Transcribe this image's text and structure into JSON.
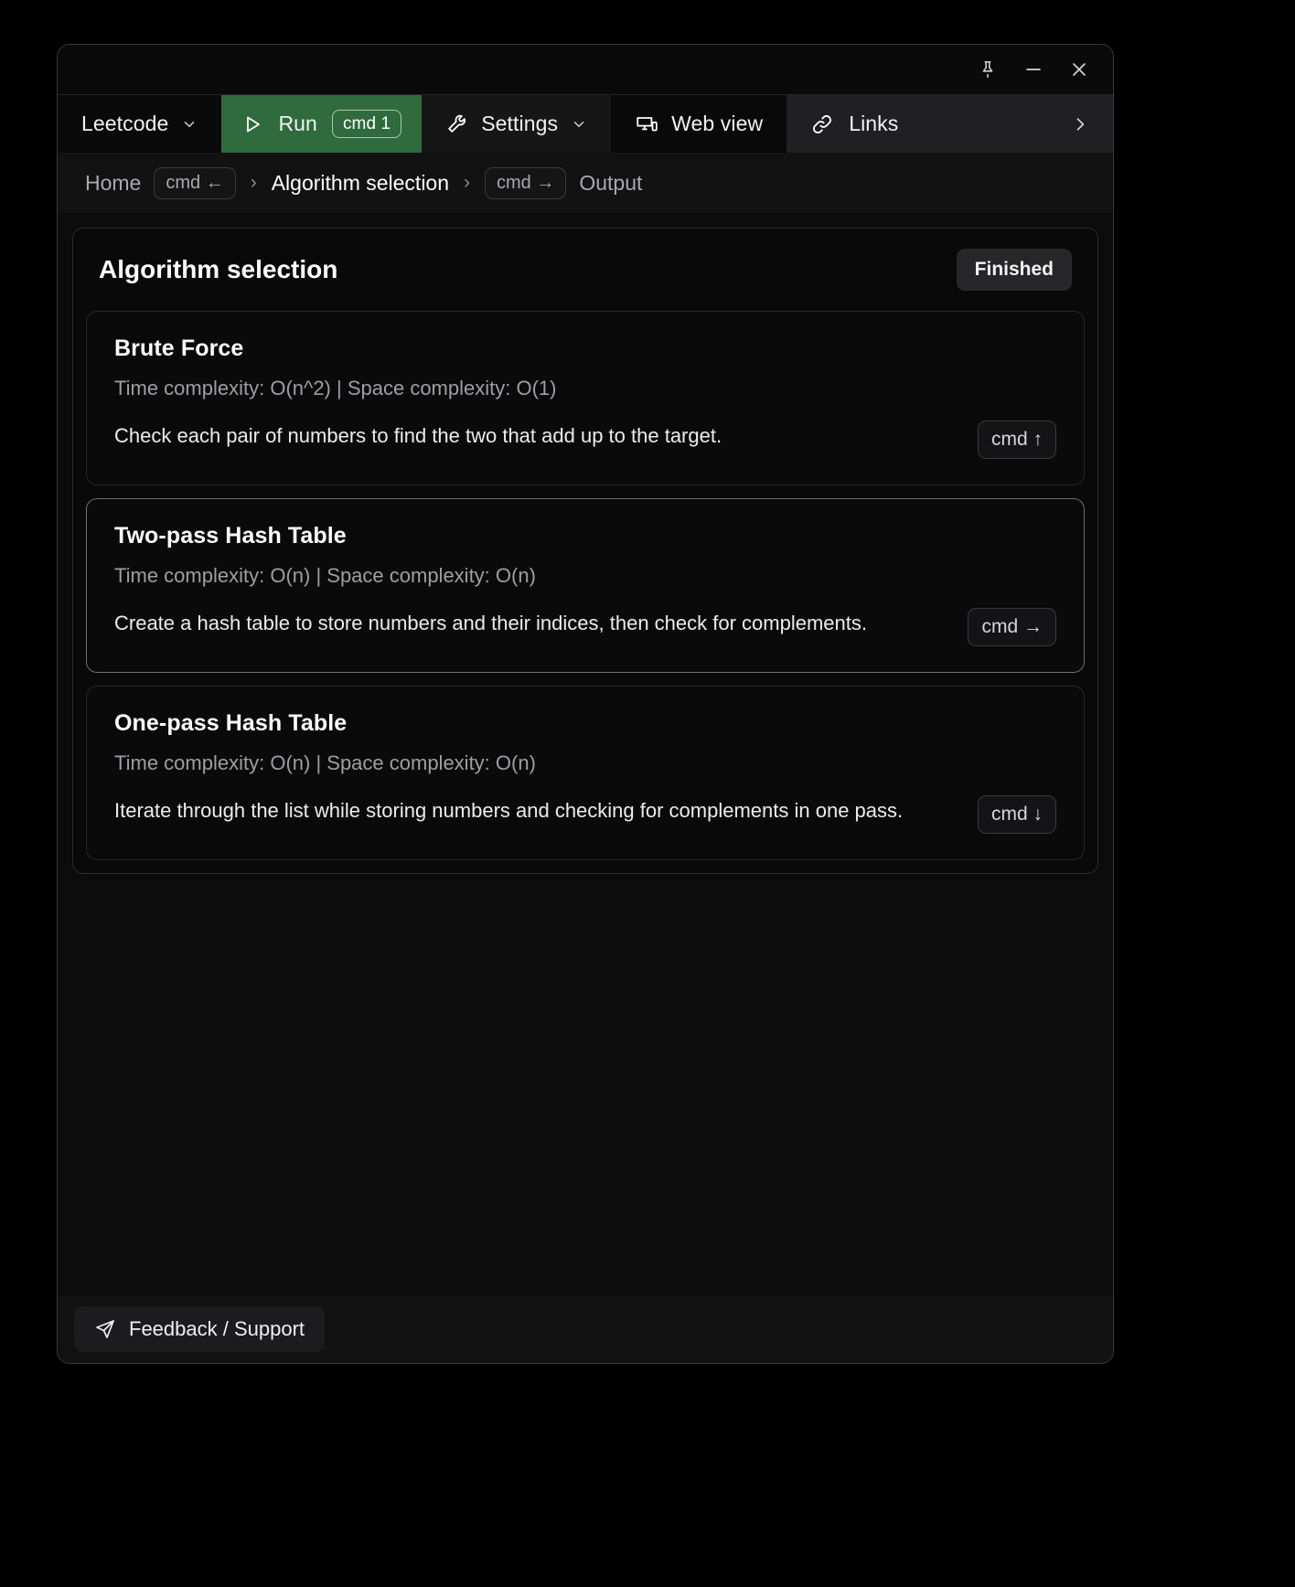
{
  "window": {
    "controls": [
      {
        "name": "pin-icon",
        "label": "Pin"
      },
      {
        "name": "minimize-icon",
        "label": "Minimize"
      },
      {
        "name": "close-icon",
        "label": "Close"
      }
    ]
  },
  "toolbar": {
    "app_menu_label": "Leetcode",
    "app_menu_chevron": "⌄",
    "run_label": "Run",
    "run_shortcut": "cmd 1",
    "run_bg": "#2f6b3c",
    "settings_label": "Settings",
    "settings_chevron": "⌄",
    "webview_label": "Web view",
    "links_label": "Links",
    "links_arrow": "›"
  },
  "breadcrumb": {
    "home_label": "Home",
    "home_shortcut": "cmd ←",
    "sep1": "›",
    "current_label": "Algorithm selection",
    "sep2": "›",
    "next_shortcut": "cmd →",
    "next_label": "Output"
  },
  "panel": {
    "title": "Algorithm selection",
    "status": "Finished"
  },
  "cards": [
    {
      "title": "Brute Force",
      "complexity": "Time complexity: O(n^2) | Space complexity: O(1)",
      "description": "Check each pair of numbers to find the two that add up to the target.",
      "cmd": "cmd ↑",
      "selected": false
    },
    {
      "title": "Two-pass Hash Table",
      "complexity": "Time complexity: O(n) | Space complexity: O(n)",
      "description": "Create a hash table to store numbers and their indices, then check for complements.",
      "cmd": "cmd →",
      "selected": true
    },
    {
      "title": "One-pass Hash Table",
      "complexity": "Time complexity: O(n) | Space complexity: O(n)",
      "description": "Iterate through the list while storing numbers and checking for complements in one pass.",
      "cmd": "cmd ↓",
      "selected": false
    }
  ],
  "footer": {
    "feedback_label": "Feedback / Support"
  }
}
